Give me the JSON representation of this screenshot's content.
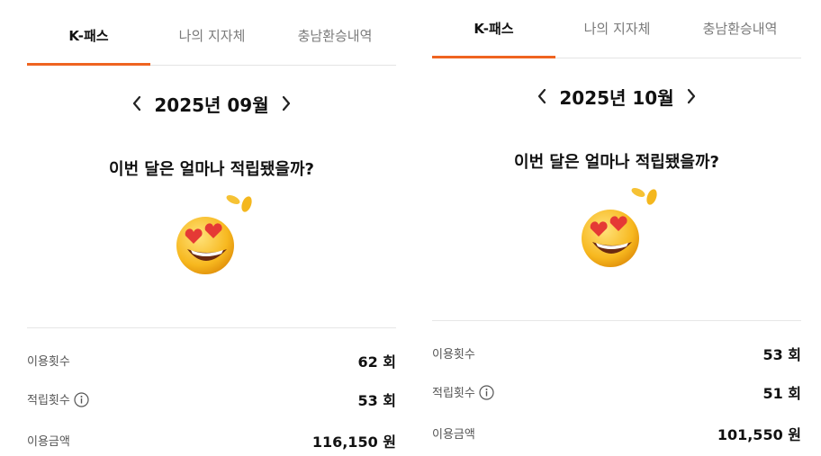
{
  "tabs": [
    "K-패스",
    "나의 지자체",
    "충남환승내역"
  ],
  "question": "이번 달은 얼마나 적립됐을까?",
  "emoji": "heart-eyes-face-with-coins-icon",
  "colors": {
    "accent": "#ef6420",
    "text": "#111111",
    "muted": "#7a7a7a"
  },
  "panels": [
    {
      "month": "2025년 09월",
      "stats": [
        {
          "label": "이용횟수",
          "value": "62 회"
        },
        {
          "label": "적립횟수",
          "value": "53 회"
        },
        {
          "label": "이용금액",
          "value": "116,150 원"
        }
      ]
    },
    {
      "month": "2025년 10월",
      "stats": [
        {
          "label": "이용횟수",
          "value": "53 회"
        },
        {
          "label": "적립횟수",
          "value": "51 회"
        },
        {
          "label": "이용금액",
          "value": "101,550 원"
        }
      ]
    }
  ]
}
